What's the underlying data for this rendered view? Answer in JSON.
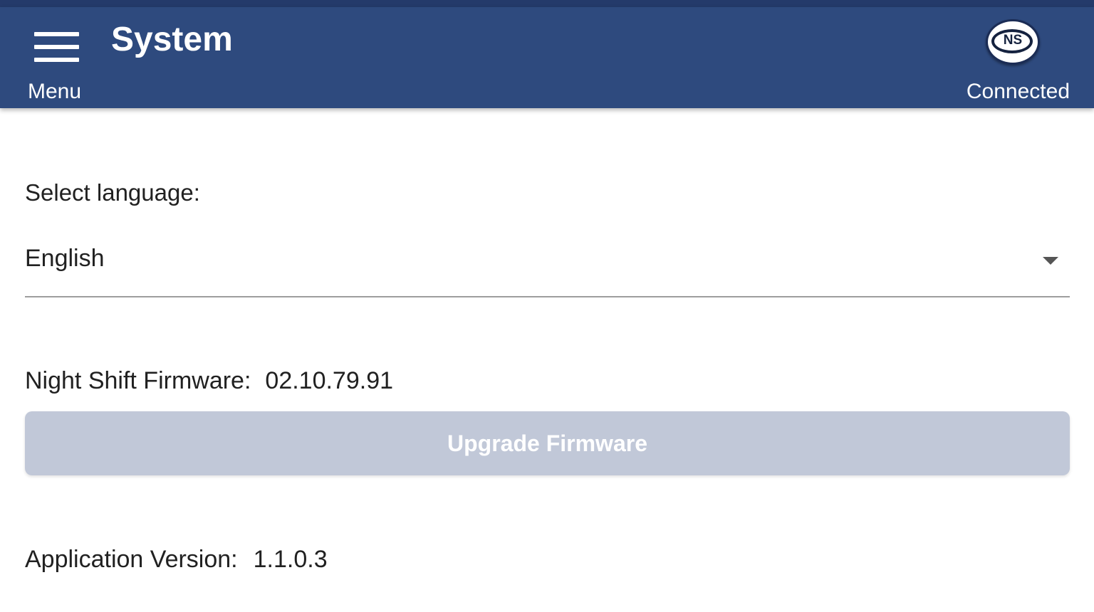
{
  "app_bar": {
    "title": "System",
    "menu_label": "Menu",
    "connection_status": "Connected",
    "logo_text": "NS",
    "colors": {
      "app_bar": "#2e4a7e",
      "status_strip": "#243a6a"
    }
  },
  "language": {
    "label": "Select language:",
    "selected": "English"
  },
  "firmware": {
    "label": "Night Shift Firmware:",
    "version": "02.10.79.91",
    "upgrade_label": "Upgrade Firmware",
    "upgrade_enabled": false,
    "button_color": "#c1c8d8"
  },
  "application": {
    "label": "Application Version:",
    "version": "1.1.0.3"
  }
}
